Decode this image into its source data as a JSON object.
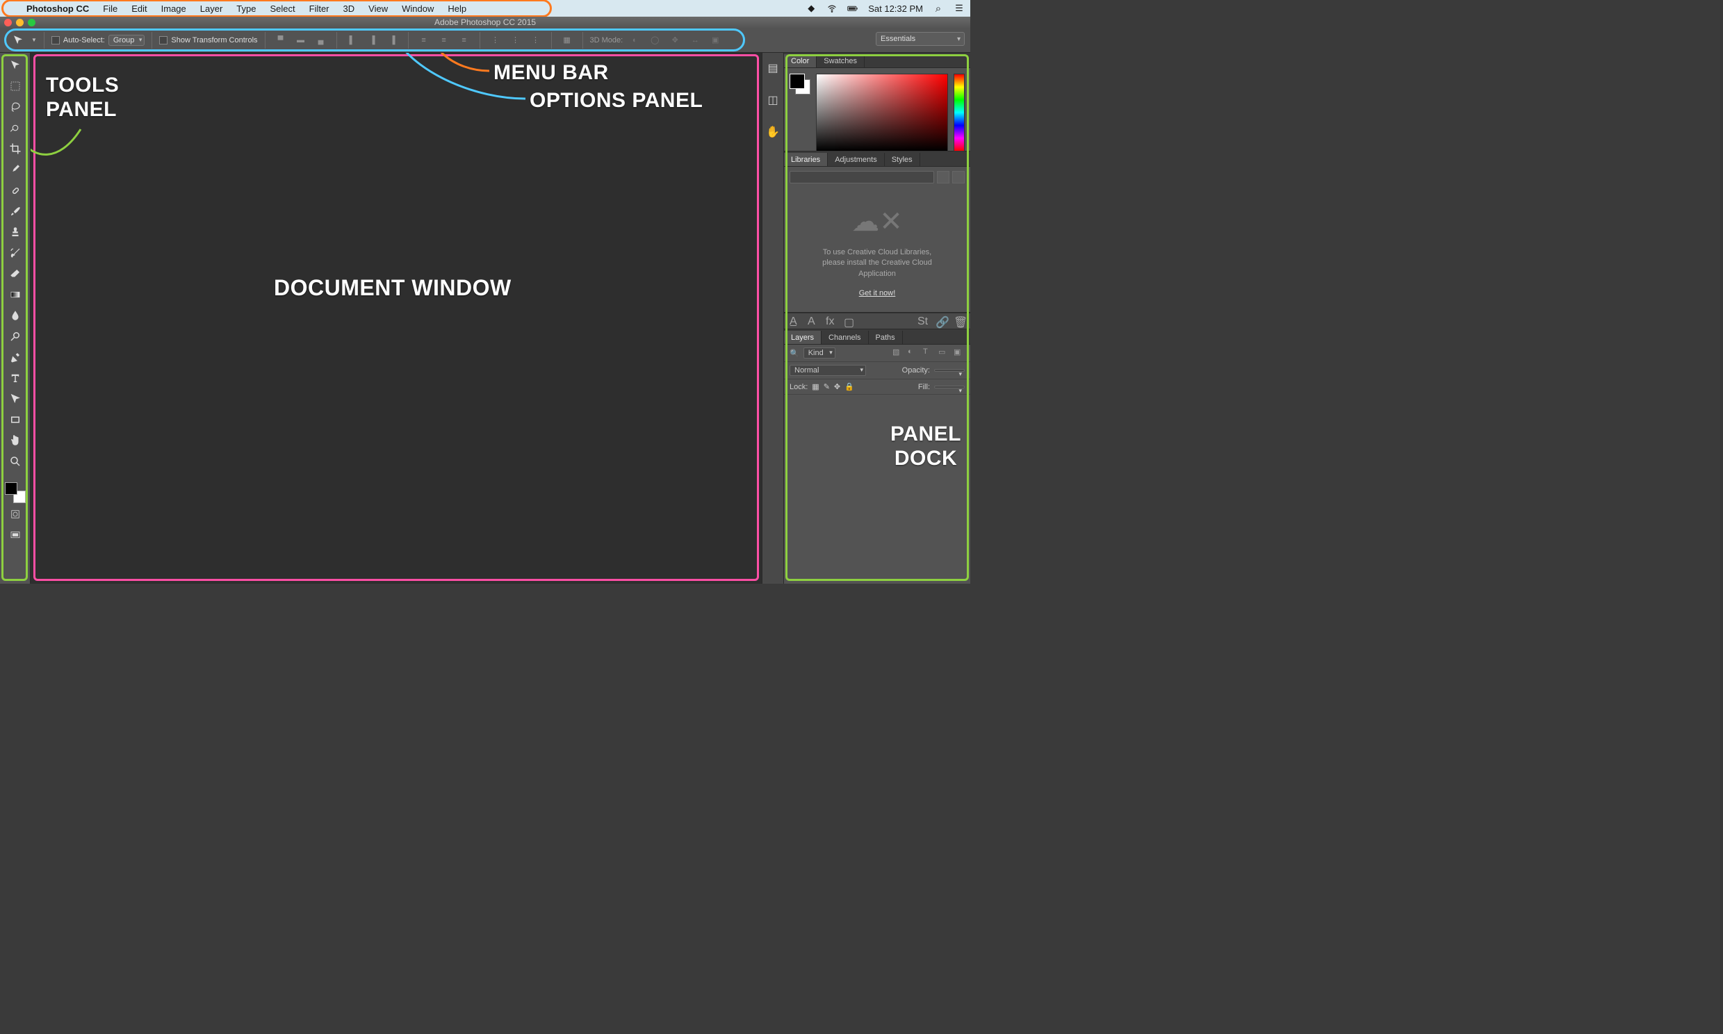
{
  "mac": {
    "apple": "",
    "app": "Photoshop CC",
    "menus": [
      "File",
      "Edit",
      "Image",
      "Layer",
      "Type",
      "Select",
      "Filter",
      "3D",
      "View",
      "Window",
      "Help"
    ],
    "clock": "Sat 12:32 PM"
  },
  "titlebar": {
    "title": "Adobe Photoshop CC 2015"
  },
  "options": {
    "auto_select": "Auto-Select:",
    "group": "Group",
    "show_transform": "Show Transform Controls",
    "mode3d": "3D Mode:",
    "workspace": "Essentials"
  },
  "tools": {
    "list": [
      "move-tool",
      "marquee-tool",
      "lasso-tool",
      "quick-select-tool",
      "crop-tool",
      "eyedropper-tool",
      "healing-tool",
      "brush-tool",
      "stamp-tool",
      "history-brush-tool",
      "eraser-tool",
      "gradient-tool",
      "blur-tool",
      "dodge-tool",
      "pen-tool",
      "type-tool",
      "path-select-tool",
      "rectangle-tool",
      "hand-tool",
      "zoom-tool"
    ]
  },
  "panels": {
    "color_tabs": [
      "Color",
      "Swatches"
    ],
    "lib_tabs": [
      "Libraries",
      "Adjustments",
      "Styles"
    ],
    "layer_tabs": [
      "Layers",
      "Channels",
      "Paths"
    ],
    "libraries": {
      "msg1": "To use Creative Cloud Libraries,",
      "msg2": "please install the Creative Cloud",
      "msg3": "Application",
      "link": "Get it now!"
    },
    "layers": {
      "kind": "Kind",
      "blend": "Normal",
      "opacity_label": "Opacity:",
      "lock_label": "Lock:",
      "fill_label": "Fill:"
    }
  },
  "annotations": {
    "tools_panel": "TOOLS\nPANEL",
    "document_window": "DOCUMENT WINDOW",
    "menu_bar": "MENU BAR",
    "options_panel": "OPTIONS PANEL",
    "panel_dock": "PANEL\nDOCK"
  }
}
